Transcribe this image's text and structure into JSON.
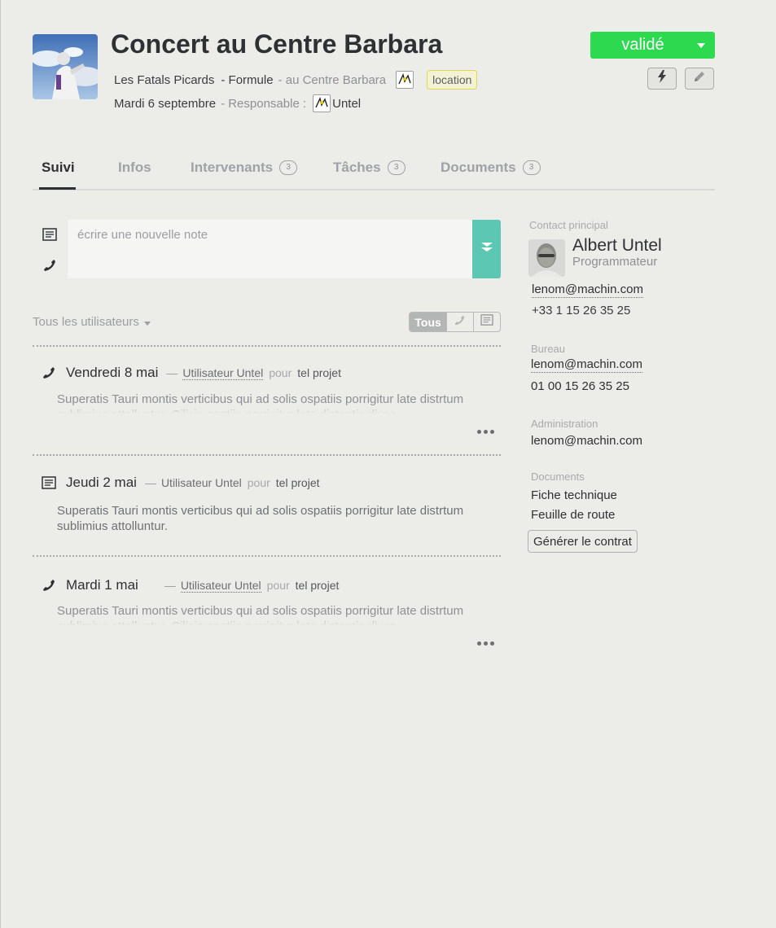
{
  "header": {
    "title": "Concert au Centre Barbara",
    "artist": "Les Fatals Picards",
    "formula": "- Formule",
    "venue": "- au Centre Barbara",
    "tag": "location",
    "date": "Mardi 6 septembre",
    "responsible_label": "- Responsable :",
    "responsible_name": "Untel",
    "status": "validé"
  },
  "tabs": [
    {
      "label": "Suivi",
      "count": null
    },
    {
      "label": "Infos",
      "count": null
    },
    {
      "label": "Intervenants",
      "count": "3"
    },
    {
      "label": "Tâches",
      "count": "3"
    },
    {
      "label": "Documents",
      "count": "3"
    }
  ],
  "composer": {
    "placeholder": "écrire une nouvelle note"
  },
  "filter": {
    "users_label": "Tous les utilisateurs",
    "all_label": "Tous"
  },
  "feed": [
    {
      "type": "phone-icon",
      "date": "Vendredi 8 mai",
      "dash": "—",
      "user": "Utilisateur Untel",
      "pour": "pour",
      "project": "tel projet",
      "body": "Superatis Tauri montis verticibus qui ad solis ospatiis porrigitur late distrtum sublimius attolluntur. Cilicia spatiis porrigitur late distentis dives"
    },
    {
      "type": "note-icon",
      "date": "Jeudi 2 mai",
      "dash": "—",
      "user": "Utilisateur Untel",
      "pour": "pour",
      "project": "tel projet",
      "body": "Superatis Tauri montis verticibus qui ad solis ospatiis porrigitur late distrtum sublimius attolluntur."
    },
    {
      "type": "phone-icon",
      "date": "Mardi 1 mai",
      "dash": "—",
      "user": "Utilisateur Untel",
      "pour": "pour",
      "project": "tel projet",
      "body": "Superatis Tauri montis verticibus qui ad solis ospatiis porrigitur late distrtum sublimius attolluntur. Cilicia spatiis porrigitur late distentis dives"
    }
  ],
  "sidebar": {
    "contact_label": "Contact principal",
    "contact_name": "Albert Untel",
    "contact_role": "Programmateur",
    "contact_email": "lenom@machin.com",
    "contact_phone": "+33 1 15 26 35 25",
    "bureau_label": "Bureau",
    "bureau_email": "lenom@machin.com",
    "bureau_phone": "01 00 15 26 35 25",
    "admin_label": "Administration",
    "admin_email": "lenom@machin.com",
    "documents_label": "Documents",
    "documents": [
      "Fiche technique",
      "Feuille de route"
    ],
    "generate_button": "Générer le contrat"
  },
  "colors": {
    "status_green": "#2cd94f",
    "accent_teal": "#5cc7b2",
    "tag_yellow": "#e2d94a"
  }
}
